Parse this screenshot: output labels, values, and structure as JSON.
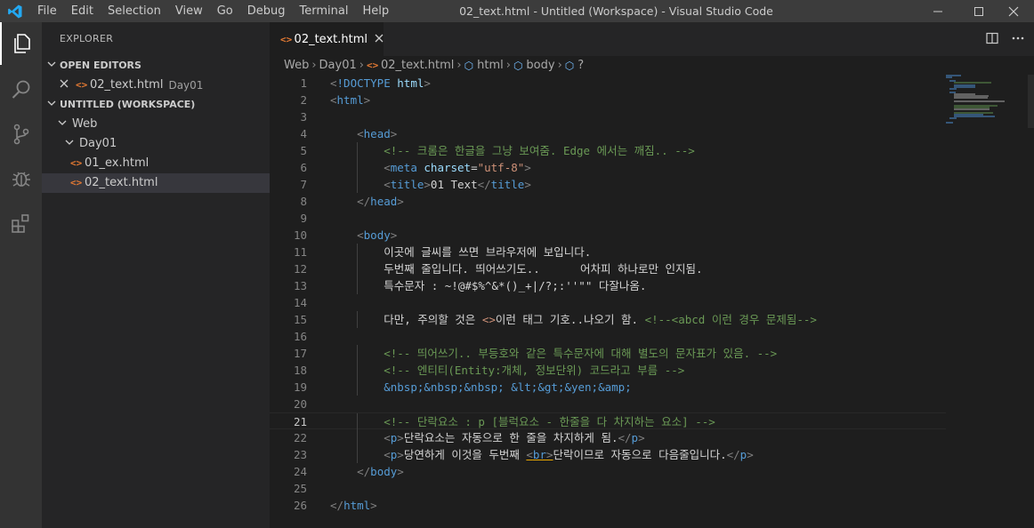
{
  "window": {
    "title": "02_text.html - Untitled (Workspace) - Visual Studio Code",
    "menu": [
      "File",
      "Edit",
      "Selection",
      "View",
      "Go",
      "Debug",
      "Terminal",
      "Help"
    ]
  },
  "colors": {
    "titlebar": "#3c3c3c",
    "activitybar": "#333333",
    "sidebar": "#252526",
    "editor": "#1e1e1e",
    "accent": "#007acc"
  },
  "activity": [
    "explorer-icon",
    "search-icon",
    "source-control-icon",
    "debug-icon",
    "extensions-icon"
  ],
  "sidebar": {
    "title": "EXPLORER",
    "open_editors": {
      "label": "OPEN EDITORS",
      "items": [
        {
          "name": "02_text.html",
          "desc": "Day01"
        }
      ]
    },
    "workspace": {
      "label": "UNTITLED (WORKSPACE)",
      "tree": [
        {
          "label": "Web",
          "kind": "folder"
        },
        {
          "label": "Day01",
          "kind": "folder"
        },
        {
          "label": "01_ex.html",
          "kind": "file"
        },
        {
          "label": "02_text.html",
          "kind": "file",
          "selected": true
        }
      ]
    }
  },
  "editor": {
    "tab": {
      "label": "02_text.html"
    },
    "breadcrumb": [
      "Web",
      "Day01",
      "02_text.html",
      "html",
      "body",
      "?"
    ],
    "lines": [
      "<!DOCTYPE html>",
      "<html>",
      "",
      "    <head>",
      "        <!-- 크롬은 한글을 그냥 보여줌. Edge 에서는 깨짐.. -->",
      "        <meta charset=\"utf-8\">",
      "        <title>01 Text</title>",
      "    </head>",
      "",
      "    <body>",
      "        이곳에 글씨를 쓰면 브라우저에 보입니다.",
      "        두번째 줄입니다. 띄어쓰기도..      어차피 하나로만 인지됨.",
      "        특수문자 : ~!@#$%^&*()_+|/?;:''\"\" 다잘나옴.",
      "",
      "        다만, 주의할 것은 <>이런 태그 기호..나오기 함. <!--<abcd 이런 경우 문제됨-->",
      "",
      "        <!-- 띄어쓰기.. 부등호와 같은 특수문자에 대해 별도의 문자표가 있음. -->",
      "        <!-- 엔티티(Entity:개체, 정보단위) 코드라고 부름 -->",
      "        &nbsp;&nbsp;&nbsp; &lt;&gt;&yen;&amp;",
      "",
      "        <!-- 단락요소 : p [블럭요소 - 한줄을 다 차지하는 요소] -->",
      "        <p>단락요소는 자동으로 한 줄을 차지하게 됨.</p>",
      "        <p>당연하게 이것을 두번째 <br>단락이므로 자동으로 다음줄입니다.</p>",
      "    </body>",
      "",
      "</html>"
    ]
  }
}
